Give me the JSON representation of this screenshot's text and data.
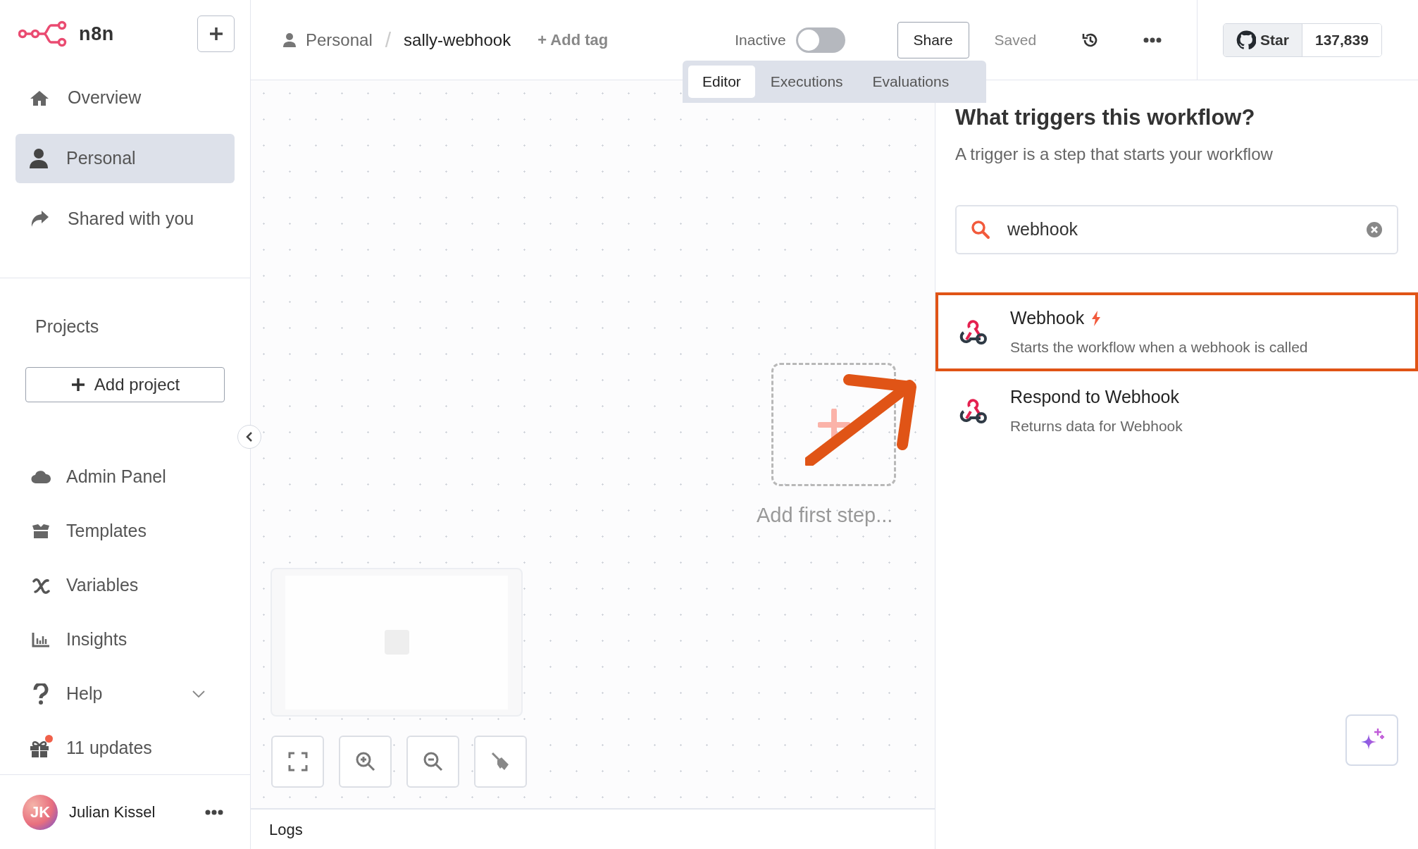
{
  "sidebar": {
    "brand": "n8n",
    "nav": [
      {
        "label": "Overview",
        "selected": false
      },
      {
        "label": "Personal",
        "selected": true
      },
      {
        "label": "Shared with you",
        "selected": false
      }
    ],
    "projects_heading": "Projects",
    "add_project": "Add project",
    "tools": [
      {
        "label": "Admin Panel",
        "kind": "link"
      },
      {
        "label": "Templates",
        "kind": "link"
      },
      {
        "label": "Variables",
        "kind": "link"
      },
      {
        "label": "Insights",
        "kind": "link"
      },
      {
        "label": "Help",
        "kind": "menu"
      },
      {
        "label": "11 updates",
        "kind": "notice"
      }
    ],
    "user": {
      "initials": "JK",
      "name": "Julian Kissel"
    }
  },
  "header": {
    "project": "Personal",
    "separator": "/",
    "workflow": "sally-webhook",
    "add_tag": "+ Add tag",
    "status_label": "Inactive",
    "active": {
      "on": false
    },
    "share": "Share",
    "saved": "Saved",
    "github_star": "Star",
    "star_count": "137,839"
  },
  "tabs": [
    {
      "label": "Editor",
      "selected": true
    },
    {
      "label": "Executions",
      "selected": false
    },
    {
      "label": "Evaluations",
      "selected": false
    }
  ],
  "canvas": {
    "add_first_step": "Add first step...",
    "logs": "Logs"
  },
  "panel": {
    "title": "What triggers this workflow?",
    "subtitle": "A trigger is a step that starts your workflow",
    "search": {
      "value": "webhook"
    },
    "results": [
      {
        "title": "Webhook",
        "description": "Starts the workflow when a webhook is called",
        "trigger": true,
        "selected": true
      },
      {
        "title": "Respond to Webhook",
        "description": "Returns data for Webhook",
        "trigger": false,
        "selected": false
      }
    ]
  }
}
